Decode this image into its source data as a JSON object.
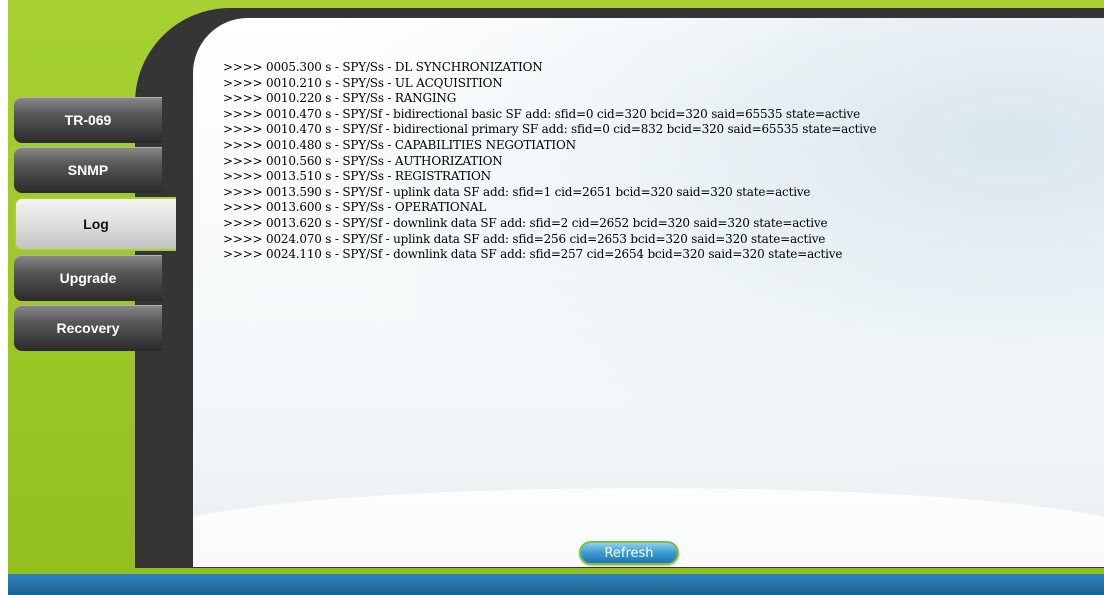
{
  "nav": {
    "items": [
      {
        "label": "TR-069",
        "active": false
      },
      {
        "label": "SNMP",
        "active": false
      },
      {
        "label": "Log",
        "active": true
      },
      {
        "label": "Upgrade",
        "active": false
      },
      {
        "label": "Recovery",
        "active": false
      }
    ]
  },
  "log": {
    "lines": [
      ">>>> 0005.300 s - SPY/Ss - DL SYNCHRONIZATION",
      ">>>> 0010.210 s - SPY/Ss - UL ACQUISITION",
      ">>>> 0010.220 s - SPY/Ss - RANGING",
      ">>>> 0010.470 s - SPY/Sf - bidirectional basic SF add: sfid=0 cid=320 bcid=320 said=65535 state=active",
      ">>>> 0010.470 s - SPY/Sf - bidirectional primary SF add: sfid=0 cid=832 bcid=320 said=65535 state=active",
      ">>>> 0010.480 s - SPY/Ss - CAPABILITIES NEGOTIATION",
      ">>>> 0010.560 s - SPY/Ss - AUTHORIZATION",
      ">>>> 0013.510 s - SPY/Ss - REGISTRATION",
      ">>>> 0013.590 s - SPY/Sf - uplink data SF add: sfid=1 cid=2651 bcid=320 said=320 state=active",
      ">>>> 0013.600 s - SPY/Ss - OPERATIONAL",
      ">>>> 0013.620 s - SPY/Sf - downlink data SF add: sfid=2 cid=2652 bcid=320 said=320 state=active",
      ">>>> 0024.070 s - SPY/Sf - uplink data SF add: sfid=256 cid=2653 bcid=320 said=320 state=active",
      ">>>> 0024.110 s - SPY/Sf - downlink data SF add: sfid=257 cid=2654 bcid=320 said=320 state=active"
    ]
  },
  "actions": {
    "refresh_label": "Refresh"
  },
  "colors": {
    "accent_green": "#a6d130",
    "frame_dark": "#353535",
    "bottom_bar_blue": "#1b5f8e",
    "button_blue": "#3a9ad3"
  }
}
